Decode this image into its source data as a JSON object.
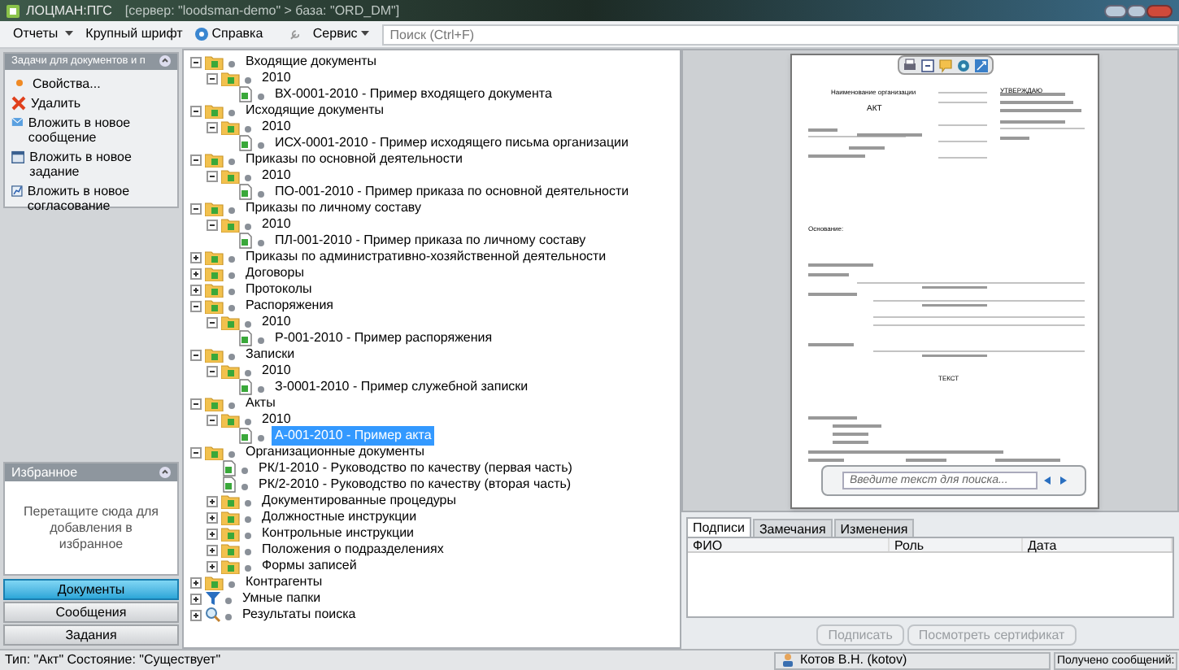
{
  "window": {
    "title": "ЛОЦМАН:ПГС",
    "subtitle": "[сервер: \"loodsman-demo\" > база: \"ORD_DM\"]"
  },
  "menu": [
    {
      "label": "Отчеты",
      "kind": "dropdown"
    },
    {
      "label": "Крупный шрифт",
      "kind": "plain"
    },
    {
      "label": "Справка",
      "kind": "help"
    }
  ],
  "toolbar_right": {
    "service": "Сервис",
    "search": {
      "placeholder": "Поиск (Ctrl+F)"
    }
  },
  "tasks_panel": {
    "title": "Задачи для документов и п",
    "items": [
      {
        "label": "Свойства...",
        "kind": "properties"
      },
      {
        "label": "Удалить",
        "kind": "delete"
      },
      {
        "label": "Вложить в новое сообщение",
        "kind": "message"
      },
      {
        "label": "Вложить в новое задание",
        "kind": "task"
      },
      {
        "label": "Вложить в новое согласование",
        "kind": "approval"
      }
    ]
  },
  "favorites_panel": {
    "title": "Избранное",
    "hint": "Перетащите сюда для добавления в избранное"
  },
  "nav_buttons": [
    {
      "label": "Документы",
      "selected": true
    },
    {
      "label": "Сообщения",
      "selected": false
    },
    {
      "label": "Задания",
      "selected": false
    }
  ],
  "tree": [
    {
      "label": "Входящие документы",
      "kind": "folder",
      "expanded": true,
      "selected": false,
      "children": [
        {
          "label": "2010",
          "kind": "folder",
          "expanded": true,
          "selected": false,
          "children": [
            {
              "label": "ВХ-0001-2010 - Пример входящего документа",
              "kind": "document",
              "selected": false
            }
          ]
        }
      ]
    },
    {
      "label": "Исходящие документы",
      "kind": "folder",
      "expanded": true,
      "selected": false,
      "children": [
        {
          "label": "2010",
          "kind": "folder",
          "expanded": true,
          "selected": false,
          "children": [
            {
              "label": "ИСХ-0001-2010 - Пример исходящего письма организации",
              "kind": "document",
              "selected": false
            }
          ]
        }
      ]
    },
    {
      "label": "Приказы по основной деятельности",
      "kind": "folder",
      "expanded": true,
      "selected": false,
      "children": [
        {
          "label": "2010",
          "kind": "folder",
          "expanded": true,
          "selected": false,
          "children": [
            {
              "label": "ПО-001-2010 - Пример приказа по основной деятельности",
              "kind": "document",
              "selected": false
            }
          ]
        }
      ]
    },
    {
      "label": "Приказы по личному составу",
      "kind": "folder",
      "expanded": true,
      "selected": false,
      "children": [
        {
          "label": "2010",
          "kind": "folder",
          "expanded": true,
          "selected": false,
          "children": [
            {
              "label": "ПЛ-001-2010 - Пример приказа по личному составу",
              "kind": "document",
              "selected": false
            }
          ]
        }
      ]
    },
    {
      "label": "Приказы по административно-хозяйственной деятельности",
      "kind": "folder",
      "expanded": false,
      "selected": false
    },
    {
      "label": "Договоры",
      "kind": "folder",
      "expanded": false,
      "selected": false
    },
    {
      "label": "Протоколы",
      "kind": "folder",
      "expanded": false,
      "selected": false
    },
    {
      "label": "Распоряжения",
      "kind": "folder",
      "expanded": true,
      "selected": false,
      "children": [
        {
          "label": "2010",
          "kind": "folder",
          "expanded": true,
          "selected": false,
          "children": [
            {
              "label": "Р-001-2010 - Пример распоряжения",
              "kind": "document",
              "selected": false
            }
          ]
        }
      ]
    },
    {
      "label": "Записки",
      "kind": "folder",
      "expanded": true,
      "selected": false,
      "children": [
        {
          "label": "2010",
          "kind": "folder",
          "expanded": true,
          "selected": false,
          "children": [
            {
              "label": "З-0001-2010 - Пример служебной записки",
              "kind": "document",
              "selected": false
            }
          ]
        }
      ]
    },
    {
      "label": "Акты",
      "kind": "folder",
      "expanded": true,
      "selected": false,
      "children": [
        {
          "label": "2010",
          "kind": "folder",
          "expanded": true,
          "selected": false,
          "children": [
            {
              "label": "А-001-2010 - Пример акта",
              "kind": "document",
              "selected": true
            }
          ]
        }
      ]
    },
    {
      "label": "Организационные документы",
      "kind": "folder",
      "expanded": true,
      "selected": false,
      "children": [
        {
          "label": "РК/1-2010 - Руководство по качеству (первая часть)",
          "kind": "document",
          "selected": false
        },
        {
          "label": "РК/2-2010 - Руководство по качеству (вторая часть)",
          "kind": "document",
          "selected": false
        },
        {
          "label": "Документированные процедуры",
          "kind": "folder",
          "expanded": false,
          "selected": false
        },
        {
          "label": "Должностные инструкции",
          "kind": "folder",
          "expanded": false,
          "selected": false
        },
        {
          "label": "Контрольные инструкции",
          "kind": "folder",
          "expanded": false,
          "selected": false
        },
        {
          "label": "Положения о подразделениях",
          "kind": "folder",
          "expanded": false,
          "selected": false
        },
        {
          "label": "Формы записей",
          "kind": "folder",
          "expanded": false,
          "selected": false
        }
      ]
    },
    {
      "label": "Контрагенты",
      "kind": "folder",
      "expanded": false,
      "selected": false
    },
    {
      "label": "Умные папки",
      "kind": "filter",
      "expanded": false,
      "selected": false
    },
    {
      "label": "Результаты поиска",
      "kind": "search",
      "expanded": false,
      "selected": false
    }
  ],
  "preview": {
    "document": {
      "organization": "Наименование организации",
      "approve": "УТВЕРЖДАЮ",
      "title": "АКТ",
      "basis": "Основание:",
      "body": "ТЕКСТ"
    },
    "search": {
      "placeholder": "Введите текст для поиска..."
    }
  },
  "tabs": [
    {
      "label": "Подписи",
      "selected": true
    },
    {
      "label": "Замечания",
      "selected": false
    },
    {
      "label": "Изменения",
      "selected": false
    }
  ],
  "table": {
    "columns": [
      "ФИО",
      "Роль",
      "Дата"
    ]
  },
  "buttons": [
    {
      "label": "Подписать",
      "disabled": true
    },
    {
      "label": "Посмотреть сертификат",
      "disabled": true
    }
  ],
  "status_bar": {
    "info": "Тип: \"Акт\"  Состояние: \"Существует\"",
    "user": "Котов В.Н. (kotov)",
    "messages": "Получено сообщений:"
  }
}
